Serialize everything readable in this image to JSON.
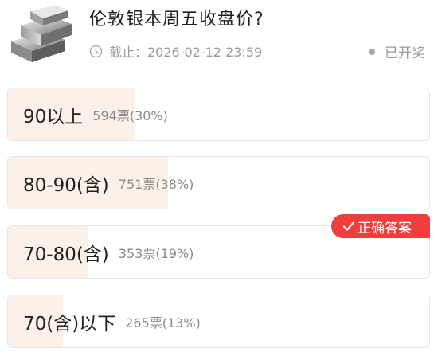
{
  "poll": {
    "title": "伦敦银本周五收盘价?",
    "deadline": "截止：2026-02-12 23:59",
    "status": "已开奖",
    "correct_badge": "正确答案"
  },
  "options": [
    {
      "label": "90以上",
      "count": "594票(30%)",
      "percent": 30
    },
    {
      "label": "80-90(含)",
      "count": "751票(38%)",
      "percent": 38
    },
    {
      "label": "70-80(含)",
      "count": "353票(19%)",
      "percent": 19,
      "correct": true
    },
    {
      "label": "70(含)以下",
      "count": "265票(13%)",
      "percent": 13
    }
  ],
  "icons": {
    "thumbnail": "silver-bars-image",
    "clock": "clock-icon",
    "status_dot": "dot-icon",
    "check": "check-icon"
  },
  "colors": {
    "accent_red": "#f23d3d",
    "bar_fill": "#fdf0e9"
  }
}
